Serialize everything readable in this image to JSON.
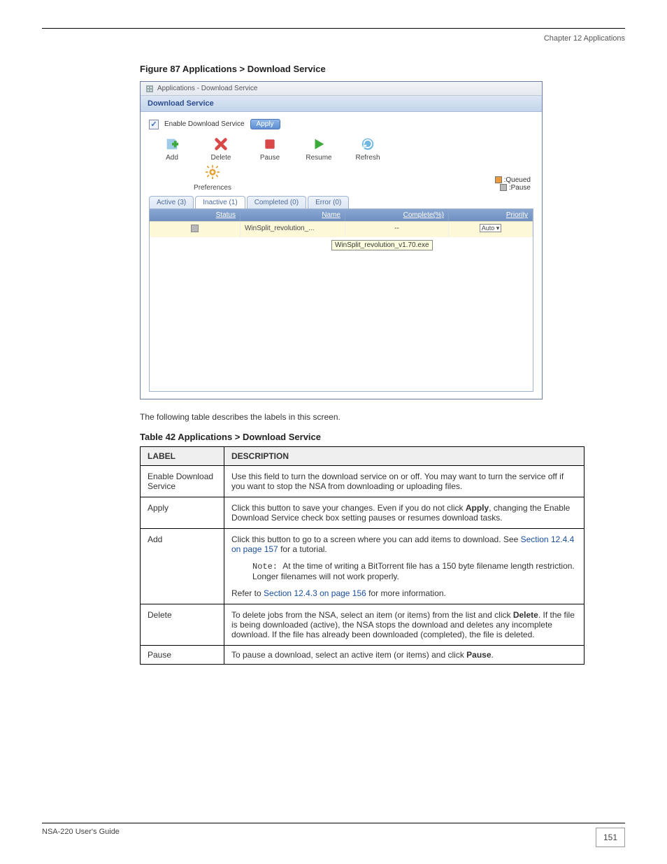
{
  "header": {
    "chapter": "Chapter 12 Applications"
  },
  "figure": {
    "caption": "Figure 87   Applications > Download Service"
  },
  "screenshot": {
    "titlebar": "Applications - Download Service",
    "section_title": "Download Service",
    "enable_label": "Enable Download Service",
    "apply_label": "Apply",
    "toolbar": {
      "add": "Add",
      "delete": "Delete",
      "pause": "Pause",
      "resume": "Resume",
      "refresh": "Refresh",
      "preferences": "Preferences"
    },
    "legend": {
      "queued": ":Queued",
      "pause": ":Pause"
    },
    "tabs": {
      "active": "Active (3)",
      "inactive": "Inactive (1)",
      "completed": "Completed (0)",
      "error": "Error (0)"
    },
    "grid": {
      "headers": {
        "status": "Status",
        "name": "Name",
        "complete": "Complete(%)",
        "priority": "Priority"
      },
      "row": {
        "name": "WinSplit_revolution_...",
        "complete": "--",
        "priority_sel": "Auto"
      },
      "tooltip": "WinSplit_revolution_v1.70.exe"
    }
  },
  "descIntro": "The following table describes the labels in this screen.",
  "tableCaption": "Table 42   Applications > Download Service",
  "descTable": {
    "h1": "LABEL",
    "h2": "DESCRIPTION",
    "rows": [
      {
        "label": "Enable Download Service",
        "desc_parts": {
          "p1": "Use this field to turn the download service on or off. You may want to turn the service off if you want to stop the NSA from downloading or uploading files."
        }
      },
      {
        "label": "Apply",
        "desc_parts": {
          "p1": "Click this button to save your changes. Even if you do not click ",
          "bold": "Apply",
          "p2": ", changing the Enable Download Service check box setting pauses or resumes download tasks."
        }
      },
      {
        "label": "Add",
        "desc_parts": {
          "p1": "Click this button to go to a screen where you can add items to download. See ",
          "link1": "Section 12.4.4 on page 157",
          "p2": " for a tutorial.",
          "note": "Note: ",
          "note_text": "At the time of writing a BitTorrent file has a 150 byte filename length restriction. Longer filenames will not work properly.",
          "refer": "Refer to ",
          "link2": "Section 12.4.3 on page 156",
          "p3": " for more information."
        }
      },
      {
        "label": "Delete",
        "desc_parts": {
          "p1": "To delete jobs from the NSA, select an item (or items) from the list and click ",
          "bold": "Delete",
          "p2": ". If the file is being downloaded (active), the NSA stops the download and deletes any incomplete download. If the file has already been downloaded (completed), the file is deleted."
        }
      },
      {
        "label": "Pause",
        "desc_parts": {
          "p1": "To pause a download, select an active item (or items) and click ",
          "bold": "Pause",
          "p2": "."
        }
      }
    ]
  },
  "footer": {
    "guide": "NSA-220 User's Guide",
    "page": "151"
  }
}
